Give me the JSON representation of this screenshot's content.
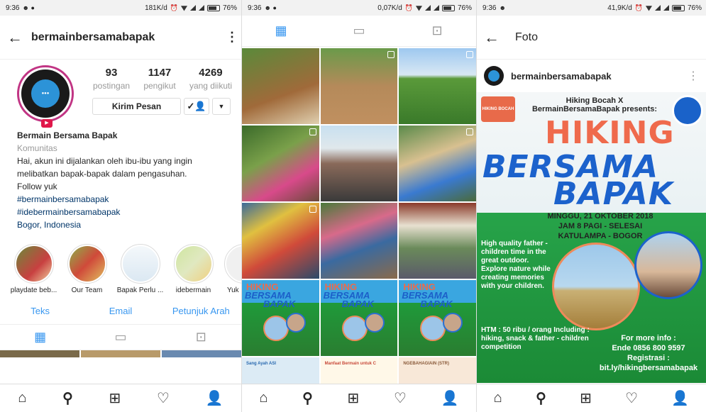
{
  "status": {
    "p1": {
      "time": "9:36",
      "speed": "181K/d",
      "battery": "76%"
    },
    "p2": {
      "time": "9:36",
      "speed": "0,07K/d",
      "battery": "76%"
    },
    "p3": {
      "time": "9:36",
      "speed": "41,9K/d",
      "battery": "76%"
    }
  },
  "profile": {
    "username": "bermainbersamabapak",
    "stats": [
      {
        "value": "93",
        "label": "postingan"
      },
      {
        "value": "1147",
        "label": "pengikut"
      },
      {
        "value": "4269",
        "label": "yang diikuti"
      }
    ],
    "message_button": "Kirim Pesan",
    "name": "Bermain Bersama Bapak",
    "category": "Komunitas",
    "bio_lines": [
      "Hai, akun ini dijalankan oleh ibu-ibu yang ingin",
      "melibatkan bapak-bapak dalam pengasuhan.",
      "Follow yuk"
    ],
    "hashtags": [
      "#bermainbersamabapak",
      "#idebermainbersamabapak"
    ],
    "location": "Bogor, Indonesia",
    "highlights": [
      "playdate beb...",
      "Our Team",
      "Bapak Perlu ...",
      "idebermain",
      "Yuk"
    ],
    "links": [
      "Teks",
      "Email",
      "Petunjuk Arah"
    ]
  },
  "post": {
    "title": "Foto",
    "username": "bermainbersamabapak",
    "poster": {
      "header": "Hiking Bocah X BermainBersamaBapak presents:",
      "badge": "HIKING BOCAH",
      "line1": "HIKING",
      "line2": "BERSAMA",
      "line3": "BAPAK",
      "date": "MINGGU, 21 OKTOBER 2018",
      "time": "JAM 8 PAGI - SELESAI",
      "place": "KATULAMPA - BOGOR",
      "desc": "High quality father - children time in the great outdoor. Explore nature while creating memories with your children.",
      "htm": "HTM : 50 ribu / orang Including : hiking, snack & father - children competition",
      "info_title": "For more info :",
      "info_contact": "Ende 0856 800 9597",
      "reg_title": "Registrasi :",
      "reg_link": "bit.ly/hikingbersamabapak"
    }
  },
  "grid_poster_text": {
    "l1": "HIKING",
    "l2": "BERSAMA",
    "l3": "BAPAK"
  },
  "grid_bottom": [
    "Sang Ayah ASI",
    "Manfaat Bermain untuk C",
    "NGEBAHAGIAIN (STR)"
  ]
}
